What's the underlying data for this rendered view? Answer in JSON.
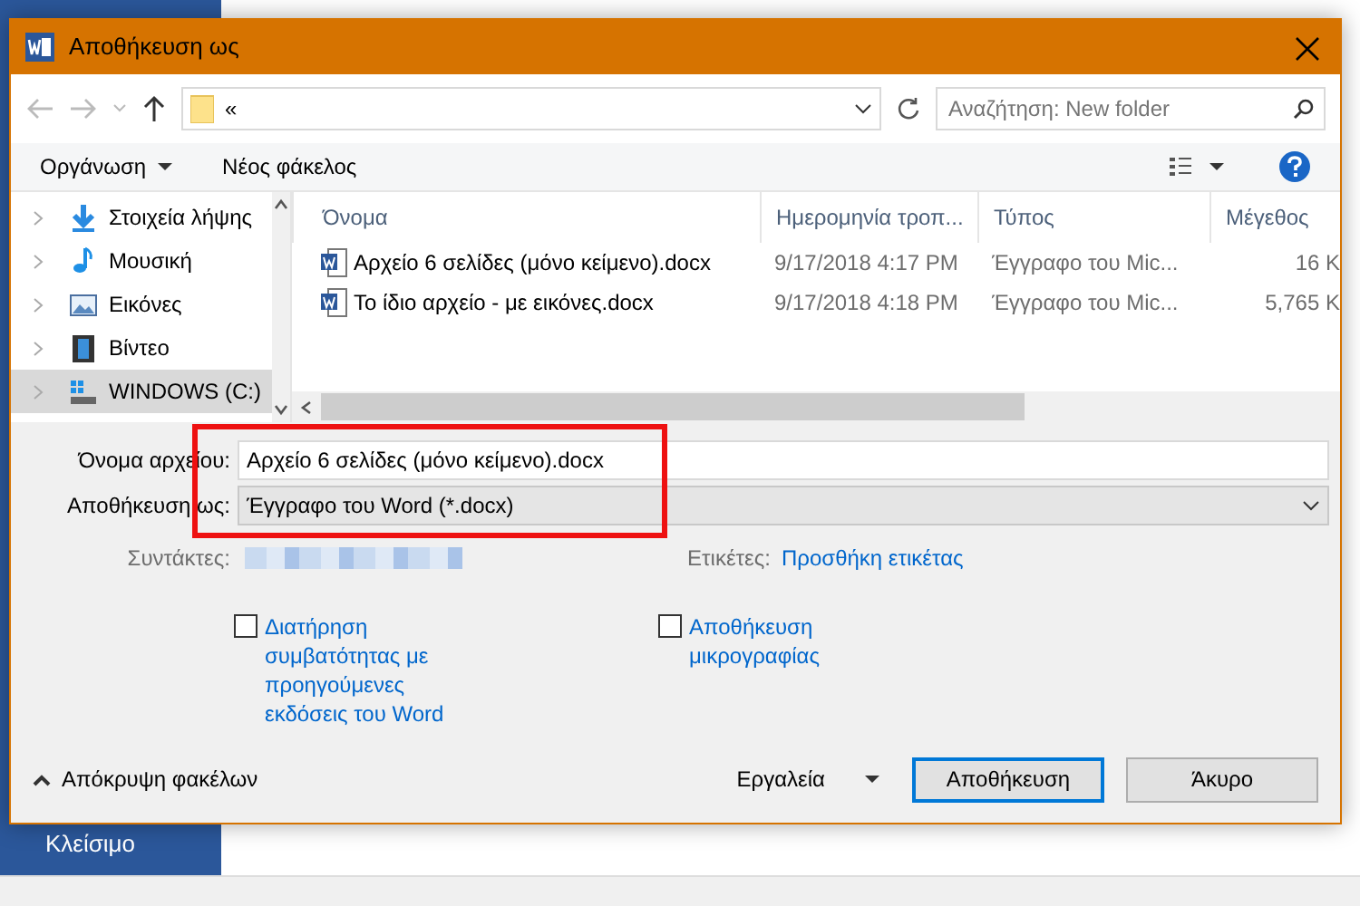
{
  "window": {
    "title": "Αποθήκευση ως"
  },
  "address_bar": {
    "path": "«"
  },
  "search": {
    "placeholder": "Αναζήτηση: New folder"
  },
  "toolbar": {
    "organize": "Οργάνωση",
    "new_folder": "Νέος φάκελος"
  },
  "sidebar": {
    "items": [
      {
        "label": "Στοιχεία λήψης",
        "kind": "downloads",
        "selected": false
      },
      {
        "label": "Μουσική",
        "kind": "music",
        "selected": false
      },
      {
        "label": "Εικόνες",
        "kind": "pictures",
        "selected": false
      },
      {
        "label": "Βίντεο",
        "kind": "video",
        "selected": false
      },
      {
        "label": "WINDOWS (C:)",
        "kind": "drive",
        "selected": true
      }
    ]
  },
  "table": {
    "columns": [
      "Όνομα",
      "Ημερομηνία τροπ...",
      "Τύπος",
      "Μέγεθος"
    ],
    "rows": [
      {
        "name": "Αρχείο 6 σελίδες (μόνο κείμενο).docx",
        "date": "9/17/2018 4:17 PM",
        "type": "Έγγραφο του Mic...",
        "size": "16 K"
      },
      {
        "name": "Το ίδιο αρχείο - με εικόνες.docx",
        "date": "9/17/2018 4:18 PM",
        "type": "Έγγραφο του Mic...",
        "size": "5,765 K"
      }
    ]
  },
  "form": {
    "filename_label": "Όνομα αρχείου:",
    "filename": "Αρχείο 6 σελίδες (μόνο κείμενο).docx",
    "savetype_label": "Αποθήκευση ως:",
    "savetype": "Έγγραφο του Word (*.docx)",
    "authors_label": "Συντάκτες:",
    "tags_label": "Ετικέτες:",
    "tags_link": "Προσθήκη ετικέτας"
  },
  "options": [
    {
      "label": "Διατήρηση συμβατότητας με προηγούμενες εκδόσεις του Word",
      "checked": false
    },
    {
      "label": "Αποθήκευση μικρογραφίας",
      "checked": false
    }
  ],
  "footer": {
    "hide_folders": "Απόκρυψη φακέλων",
    "tools": "Εργαλεία",
    "save": "Αποθήκευση",
    "cancel": "Άκυρο"
  },
  "background": {
    "close_item": "Κλείσιμο"
  }
}
